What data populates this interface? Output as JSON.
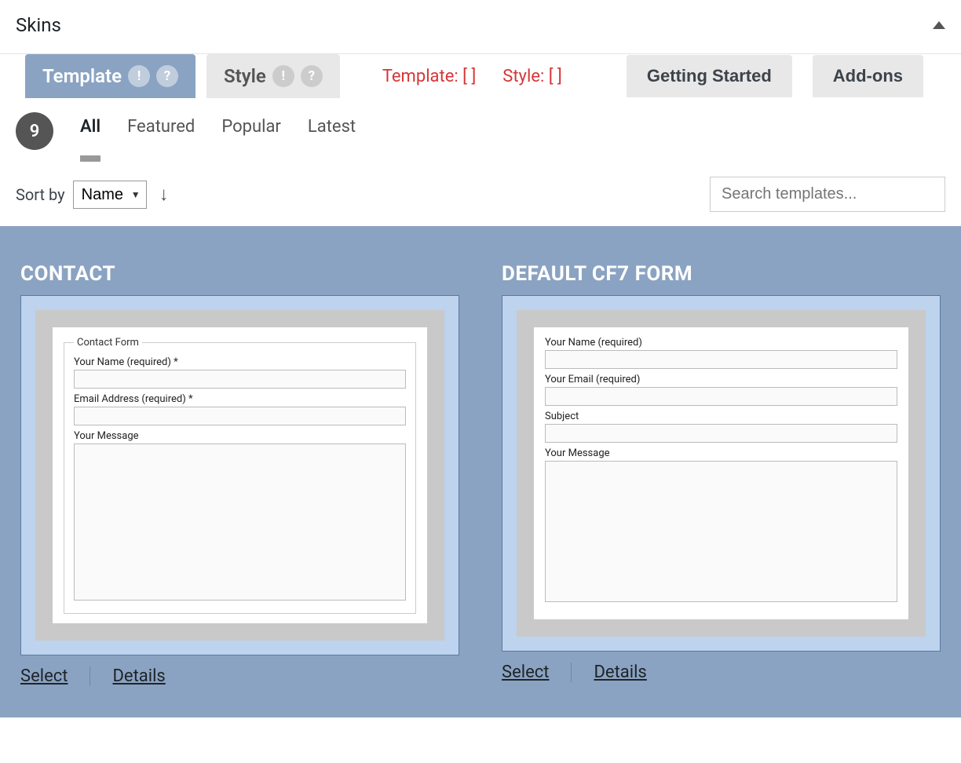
{
  "header": {
    "title": "Skins"
  },
  "tabs": {
    "template": {
      "label": "Template",
      "badge1": "!",
      "badge2": "?"
    },
    "style": {
      "label": "Style",
      "badge1": "!",
      "badge2": "?"
    }
  },
  "status": {
    "template": "Template:  [   ]",
    "style": "Style:  [   ]"
  },
  "nav_buttons": {
    "getting_started": "Getting Started",
    "addons": "Add-ons"
  },
  "filters": {
    "count": "9",
    "all": "All",
    "featured": "Featured",
    "popular": "Popular",
    "latest": "Latest"
  },
  "sort": {
    "label": "Sort by",
    "selected": "Name"
  },
  "search": {
    "placeholder": "Search templates..."
  },
  "cards": [
    {
      "title": "CONTACT",
      "legend": "Contact Form",
      "fields": [
        {
          "label": "Your Name (required) *",
          "type": "text"
        },
        {
          "label": "Email Address (required) *",
          "type": "text"
        },
        {
          "label": "Your Message",
          "type": "textarea"
        }
      ],
      "select": "Select",
      "details": "Details"
    },
    {
      "title": "DEFAULT CF7 FORM",
      "legend": "",
      "fields": [
        {
          "label": "Your Name (required)",
          "type": "text"
        },
        {
          "label": "Your Email (required)",
          "type": "text"
        },
        {
          "label": "Subject",
          "type": "text"
        },
        {
          "label": "Your Message",
          "type": "textarea"
        }
      ],
      "select": "Select",
      "details": "Details"
    }
  ]
}
